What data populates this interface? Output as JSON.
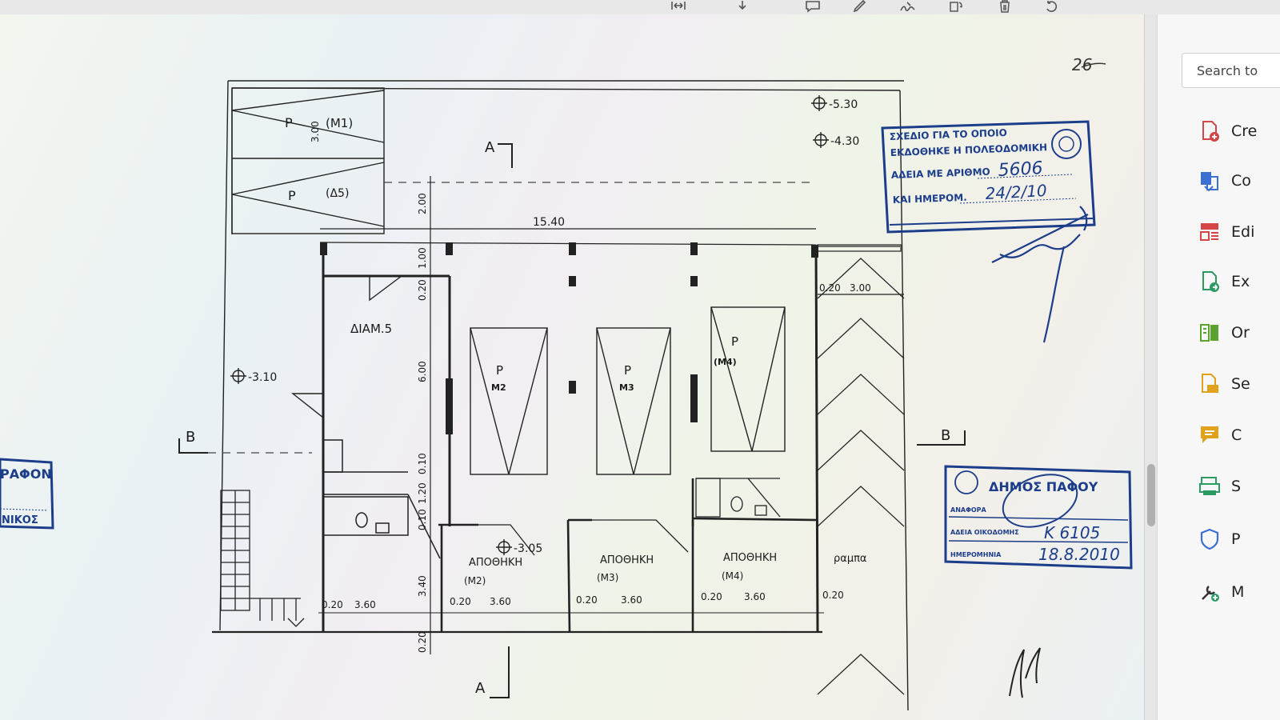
{
  "toolbar": {
    "icons": [
      "fit-width-icon",
      "download-icon",
      "comment-icon",
      "highlight-icon",
      "sign-icon",
      "rotate-page-icon",
      "delete-icon",
      "undo-icon"
    ]
  },
  "sidebar": {
    "search_placeholder": "Search to",
    "tools": [
      {
        "label": "Cre",
        "icon": "create-pdf-icon",
        "color": "#d64545"
      },
      {
        "label": "Co",
        "icon": "combine-files-icon",
        "color": "#3b6fd1"
      },
      {
        "label": "Edi",
        "icon": "edit-pdf-icon",
        "color": "#d64545"
      },
      {
        "label": "Ex",
        "icon": "export-pdf-icon",
        "color": "#2b9b63"
      },
      {
        "label": "Or",
        "icon": "organize-pages-icon",
        "color": "#5aa12e"
      },
      {
        "label": "Se",
        "icon": "send-for-comments-icon",
        "color": "#e0a21b"
      },
      {
        "label": "C",
        "icon": "comment-tool-icon",
        "color": "#e0a21b"
      },
      {
        "label": "S",
        "icon": "scan-icon",
        "color": "#2b9b63"
      },
      {
        "label": "P",
        "icon": "protect-icon",
        "color": "#3b6fd1"
      },
      {
        "label": "M",
        "icon": "more-tools-icon",
        "color": "#333333"
      }
    ]
  },
  "plan": {
    "page_number_mark": "26",
    "level_top_1": "-5.30",
    "level_top_2": "-4.30",
    "level_left": "-3.10",
    "level_store": "-3.05",
    "section_a_top": "A",
    "section_a_bottom": "A",
    "section_b_left": "B",
    "section_b_right": "B",
    "parking_m1": "P",
    "parking_m1_code": "(M1)",
    "parking_m1_dim": "3.00",
    "parking_d5": "P",
    "parking_d5_code": "(Δ5)",
    "parking_m2": "P",
    "parking_m2_code": "M2",
    "parking_m3": "P",
    "parking_m3_code": "M3",
    "parking_m4": "P",
    "parking_m4_code": "(M4)",
    "flat_label": "ΔΙΑΜ.5",
    "store_label": "ΑΠΟΘΗΚΗ",
    "store_m2": "(M2)",
    "store_m3": "(M3)",
    "store_m4": "(M4)",
    "ramp_label": "ραμπα",
    "dim_total": "15.40",
    "dim_200": "2.00",
    "dim_100": "1.00",
    "dim_020_v": "0.20",
    "dim_600": "6.00",
    "dim_010a": "0.10",
    "dim_120": "1.20",
    "dim_010b": "0.10",
    "dim_340": "3.40",
    "dim_020_bottom": "0.20",
    "dim_ramp_020": "0.20",
    "dim_ramp_300": "3.00",
    "dim_020": "0.20",
    "dim_360": "3.60",
    "left_stamp_line1": "ΡΑΦΟΝ",
    "left_stamp_line2": "ΝΙΚΟΣ"
  },
  "stamp_permit": {
    "line1": "ΣΧΕΔΙΟ ΓΙΑ ΤΟ ΟΠΟΙΟ",
    "line2": "ΕΚΔΟΘΗΚΕ Η ΠΟΛΕΟΔΟΜΙΚΗ",
    "line3_label": "ΑΔΕΙΑ ΜΕ ΑΡΙΘΜΟ",
    "line3_value": "5606",
    "line4_label": "ΚΑΙ ΗΜΕΡΟΜ.",
    "line4_value": "24/2/10"
  },
  "stamp_municipality": {
    "title": "ΔΗΜΟΣ ΠΑΦΟΥ",
    "row1_label": "ΑΝΑΦΟΡΑ",
    "row2_label": "ΑΔΕΙΑ ΟΙΚΟΔΟΜΗΣ",
    "row2_value": "Κ 6105",
    "row3_label": "ΗΜΕΡΟΜΗΝΙΑ",
    "row3_value": "18.8.2010"
  }
}
